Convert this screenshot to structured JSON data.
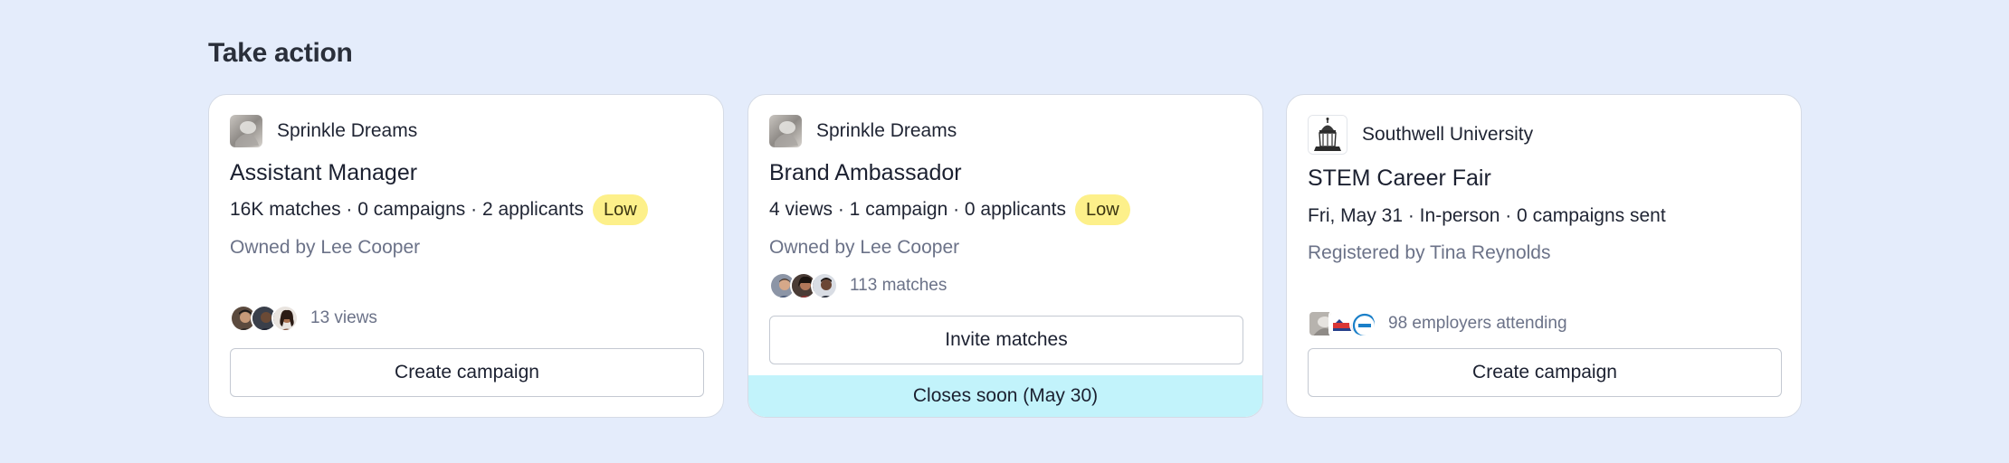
{
  "section": {
    "title": "Take action"
  },
  "cards": [
    {
      "org_name": "Sprinkle Dreams",
      "org_logo_icon": "sprinkle-dreams-logo",
      "title": "Assistant Manager",
      "stats": "16K matches · 0 campaigns · 2 applicants",
      "priority": "Low",
      "owner": "Owned by Lee Cooper",
      "avatars_text": "13 views",
      "button_label": "Create campaign"
    },
    {
      "org_name": "Sprinkle Dreams",
      "org_logo_icon": "sprinkle-dreams-logo",
      "title": "Brand Ambassador",
      "stats": "4 views · 1 campaign · 0 applicants",
      "priority": "Low",
      "owner": "Owned by Lee Cooper",
      "avatars_text": "113 matches",
      "button_label": "Invite matches",
      "footer": "Closes soon (May 30)"
    },
    {
      "org_name": "Southwell University",
      "org_logo_icon": "university-crest-logo",
      "title": "STEM Career Fair",
      "stats": "Fri, May 31 · In-person · 0 campaigns sent",
      "owner": "Registered by Tina Reynolds",
      "avatars_text": "98 employers attending",
      "button_label": "Create campaign"
    }
  ],
  "colors": {
    "page_background": "#e4ecfb",
    "priority_badge": "#fdf08a",
    "closing_banner": "#c2f3fb",
    "muted_text": "#6b7288"
  }
}
